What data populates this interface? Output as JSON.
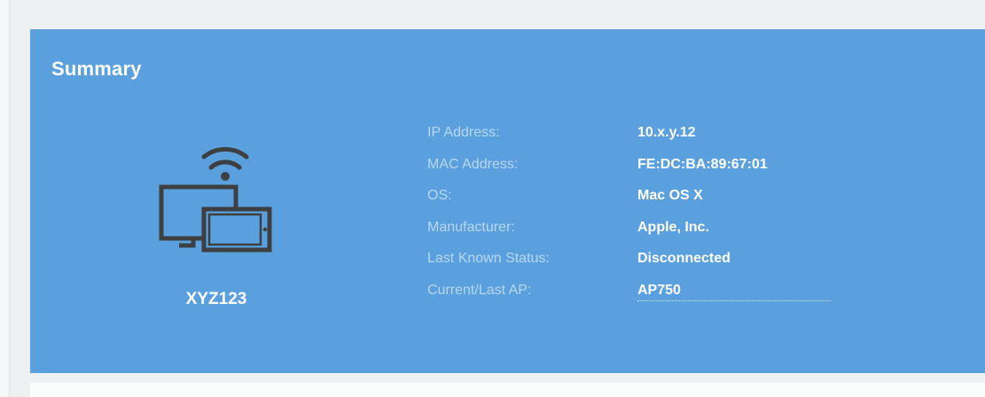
{
  "summary": {
    "title": "Summary",
    "device_name": "XYZ123",
    "details": [
      {
        "label": "IP Address:",
        "value": "10.x.y.12"
      },
      {
        "label": "MAC Address:",
        "value": "FE:DC:BA:89:67:01"
      },
      {
        "label": "OS:",
        "value": "Mac OS X"
      },
      {
        "label": "Manufacturer:",
        "value": "Apple, Inc."
      },
      {
        "label": "Last Known Status:",
        "value": "Disconnected"
      },
      {
        "label": "Current/Last AP:",
        "value": "AP750"
      }
    ]
  },
  "icons": {
    "device": "wireless-devices-icon"
  },
  "colors": {
    "card_background": "#5ba0de",
    "label_text": "#b7d7f2",
    "value_text": "#ffffff",
    "icon_stroke": "#3d3f41",
    "page_background": "#eef1f2"
  }
}
